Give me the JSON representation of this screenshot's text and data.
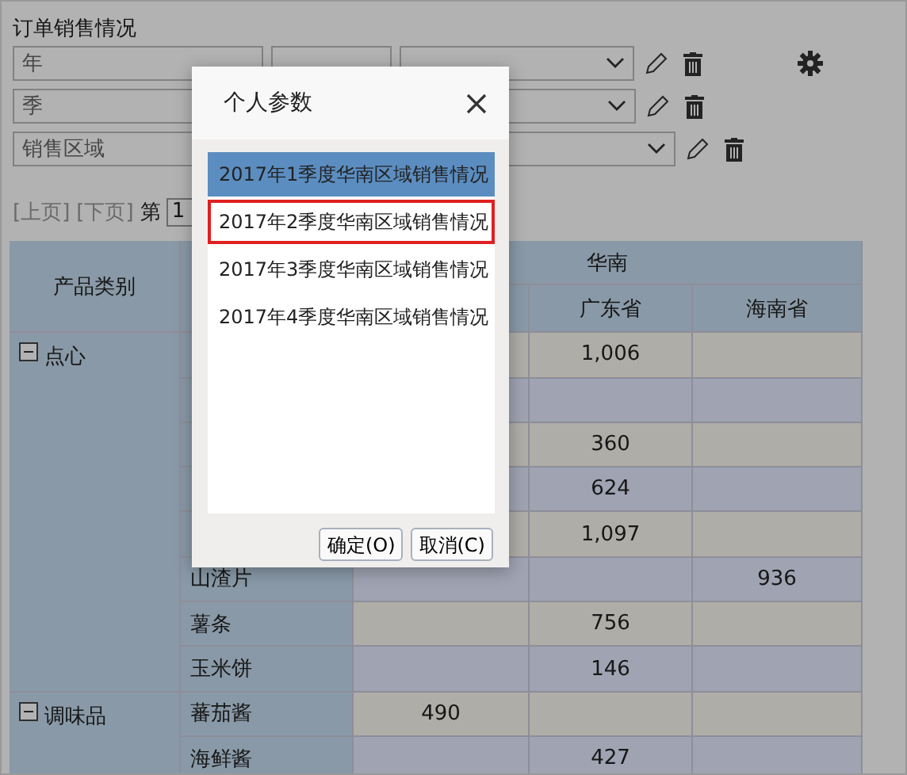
{
  "report_title": "订单销售情况",
  "filters": [
    {
      "kind": "compare",
      "field": "年"
    },
    {
      "kind": "select",
      "field": "季"
    },
    {
      "kind": "wide",
      "field": "销售区域"
    }
  ],
  "pager": {
    "prev": "[上页]",
    "next": "[下页]",
    "page_label": "第",
    "page": "1"
  },
  "table": {
    "corner": "产品类别",
    "region": "华南",
    "columns": {
      "column_4": "广东省",
      "column_5": "海南省"
    },
    "groups": [
      {
        "name": "点心",
        "expanded": true,
        "rows": [
          {
            "column_4": "1,006"
          },
          {},
          {
            "column_4": "360"
          },
          {
            "column_4": "624"
          },
          {
            "column_4": "1,097"
          },
          {
            "product": "山渣片",
            "column_5": "936"
          },
          {
            "product": "薯条",
            "column_4": "756"
          },
          {
            "product": "玉米饼",
            "column_4": "146"
          }
        ]
      },
      {
        "name": "调味品",
        "expanded": true,
        "rows": [
          {
            "product": "蕃茄酱",
            "column_3": "490"
          },
          {
            "product": "海鲜酱",
            "column_4": "427"
          }
        ]
      }
    ]
  },
  "dialog": {
    "title": "个人参数",
    "items": [
      {
        "label": "2017年1季度华南区域销售情况",
        "selected": true,
        "focused": false
      },
      {
        "label": "2017年2季度华南区域销售情况",
        "selected": false,
        "focused": true
      },
      {
        "label": "2017年3季度华南区域销售情况",
        "selected": false,
        "focused": false
      },
      {
        "label": "2017年4季度华南区域销售情况",
        "selected": false,
        "focused": false
      }
    ],
    "buttons": [
      "确定(O)",
      "取消(C)"
    ]
  }
}
